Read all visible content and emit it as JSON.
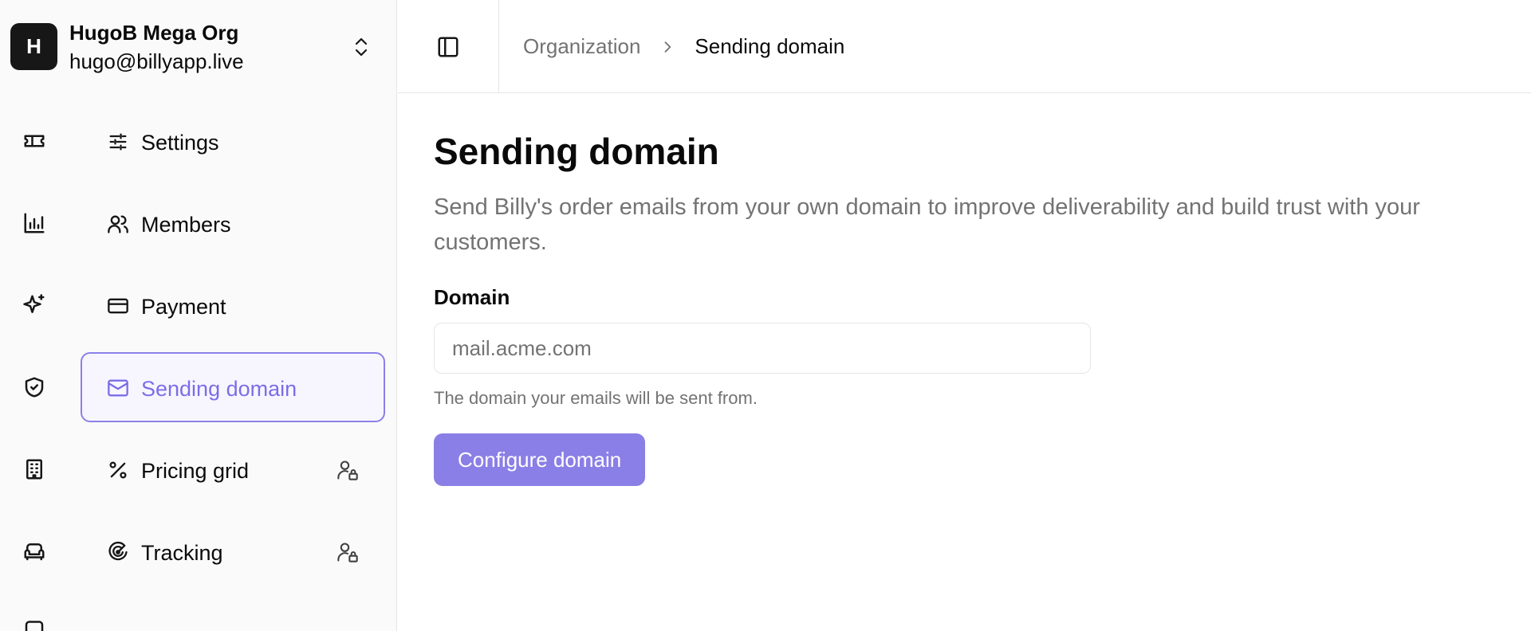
{
  "org": {
    "avatar_letter": "H",
    "name": "HugoB Mega Org",
    "email": "hugo@billyapp.live",
    "switcher_icon": "chevrons-up-down-icon"
  },
  "rail": {
    "icons": [
      "ticket-icon",
      "bar-chart-icon",
      "sparkles-icon",
      "shield-check-icon",
      "building-icon",
      "sofa-icon",
      "partial-icon"
    ]
  },
  "nav": {
    "items": [
      {
        "label": "Settings",
        "icon": "sliders-icon",
        "active": false,
        "restricted": false
      },
      {
        "label": "Members",
        "icon": "users-icon",
        "active": false,
        "restricted": false
      },
      {
        "label": "Payment",
        "icon": "credit-card-icon",
        "active": false,
        "restricted": false
      },
      {
        "label": "Sending domain",
        "icon": "mail-icon",
        "active": true,
        "restricted": false
      },
      {
        "label": "Pricing grid",
        "icon": "percent-icon",
        "active": false,
        "restricted": true
      },
      {
        "label": "Tracking",
        "icon": "radar-icon",
        "active": false,
        "restricted": true
      }
    ]
  },
  "topbar": {
    "toggle_icon": "panel-left-icon",
    "breadcrumb": {
      "parent": "Organization",
      "current": "Sending domain"
    }
  },
  "main": {
    "title": "Sending domain",
    "description": "Send Billy's order emails from your own domain to improve deliverability and build trust with your customers.",
    "field": {
      "label": "Domain",
      "value": "",
      "placeholder": "mail.acme.com",
      "help": "The domain your emails will be sent from."
    },
    "button_label": "Configure domain"
  },
  "colors": {
    "accent": "#8a7fe6",
    "accent_text": "#7b6ee6",
    "active_bg": "#f7f6ff",
    "muted_text": "#737373",
    "sidebar_bg": "#fafafa"
  }
}
